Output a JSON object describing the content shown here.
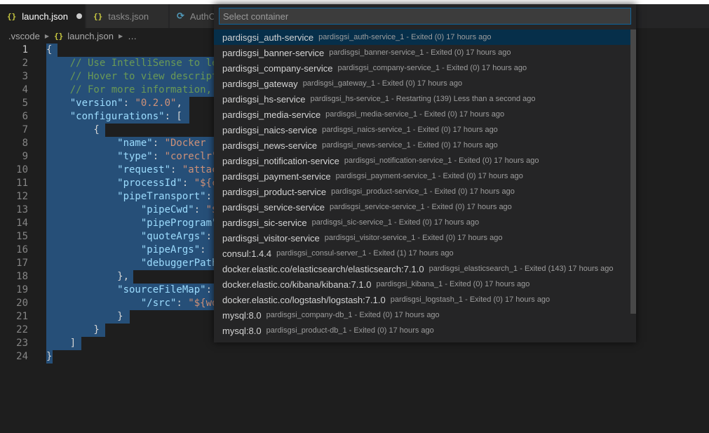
{
  "tabs": [
    {
      "label": "launch.json",
      "icon": "{}",
      "active": true,
      "dirty": true
    },
    {
      "label": "tasks.json",
      "icon": "{}",
      "active": false
    },
    {
      "label": "AuthC",
      "icon": "C#",
      "active": false
    }
  ],
  "breadcrumb": {
    "folder": ".vscode",
    "file": "launch.json",
    "more": "…"
  },
  "editor": {
    "lines": [
      {
        "n": "1",
        "tokens": [
          [
            "pun",
            "{"
          ]
        ]
      },
      {
        "n": "2",
        "tokens": [
          [
            "com",
            "    // Use IntelliSense to le"
          ]
        ]
      },
      {
        "n": "3",
        "tokens": [
          [
            "com",
            "    // Hover to view descript"
          ]
        ]
      },
      {
        "n": "4",
        "tokens": [
          [
            "com",
            "    // For more information, "
          ]
        ]
      },
      {
        "n": "5",
        "tokens": [
          [
            "key",
            "    \"version\""
          ],
          [
            "pun",
            ": "
          ],
          [
            "str",
            "\"0.2.0\""
          ],
          [
            "pun",
            ","
          ]
        ]
      },
      {
        "n": "6",
        "tokens": [
          [
            "key",
            "    \"configurations\""
          ],
          [
            "pun",
            ": ["
          ]
        ]
      },
      {
        "n": "7",
        "tokens": [
          [
            "pun",
            "        {"
          ]
        ]
      },
      {
        "n": "8",
        "tokens": [
          [
            "key",
            "            \"name\""
          ],
          [
            "pun",
            ": "
          ],
          [
            "str",
            "\"Docker ."
          ]
        ]
      },
      {
        "n": "9",
        "tokens": [
          [
            "key",
            "            \"type\""
          ],
          [
            "pun",
            ": "
          ],
          [
            "str",
            "\"coreclr\""
          ]
        ]
      },
      {
        "n": "10",
        "tokens": [
          [
            "key",
            "            \"request\""
          ],
          [
            "pun",
            ": "
          ],
          [
            "str",
            "\"attac"
          ]
        ]
      },
      {
        "n": "11",
        "tokens": [
          [
            "key",
            "            \"processId\""
          ],
          [
            "pun",
            ": "
          ],
          [
            "str",
            "\"${c"
          ]
        ]
      },
      {
        "n": "12",
        "tokens": [
          [
            "key",
            "            \"pipeTransport\""
          ],
          [
            "pun",
            ":"
          ]
        ]
      },
      {
        "n": "13",
        "tokens": [
          [
            "key",
            "                \"pipeCwd\""
          ],
          [
            "pun",
            ": "
          ],
          [
            "str",
            "\"$"
          ]
        ]
      },
      {
        "n": "14",
        "tokens": [
          [
            "key",
            "                \"pipeProgram\""
          ]
        ]
      },
      {
        "n": "15",
        "tokens": [
          [
            "key",
            "                \"quoteArgs\""
          ],
          [
            "pun",
            ":"
          ]
        ]
      },
      {
        "n": "16",
        "tokens": [
          [
            "key",
            "                \"pipeArgs\""
          ],
          [
            "pun",
            ": ["
          ]
        ]
      },
      {
        "n": "17",
        "tokens": [
          [
            "key",
            "                \"debuggerPath"
          ]
        ]
      },
      {
        "n": "18",
        "tokens": [
          [
            "pun",
            "            },"
          ]
        ]
      },
      {
        "n": "19",
        "tokens": [
          [
            "key",
            "            \"sourceFileMap\""
          ],
          [
            "pun",
            ":"
          ]
        ]
      },
      {
        "n": "20",
        "tokens": [
          [
            "key",
            "                \"/src\""
          ],
          [
            "pun",
            ": "
          ],
          [
            "str",
            "\"${wo"
          ]
        ]
      },
      {
        "n": "21",
        "tokens": [
          [
            "pun",
            "            }"
          ]
        ]
      },
      {
        "n": "22",
        "tokens": [
          [
            "pun",
            "        }"
          ]
        ]
      },
      {
        "n": "23",
        "tokens": [
          [
            "pun",
            "    ]"
          ]
        ]
      },
      {
        "n": "24",
        "tokens": [
          [
            "pun",
            "}"
          ]
        ]
      }
    ]
  },
  "quickpick": {
    "placeholder": "Select container",
    "items": [
      {
        "label": "pardisgsi_auth-service",
        "description": "pardisgsi_auth-service_1 - Exited (0) 17 hours ago",
        "active": true
      },
      {
        "label": "pardisgsi_banner-service",
        "description": "pardisgsi_banner-service_1 - Exited (0) 17 hours ago"
      },
      {
        "label": "pardisgsi_company-service",
        "description": "pardisgsi_company-service_1 - Exited (0) 17 hours ago"
      },
      {
        "label": "pardisgsi_gateway",
        "description": "pardisgsi_gateway_1 - Exited (0) 17 hours ago"
      },
      {
        "label": "pardisgsi_hs-service",
        "description": "pardisgsi_hs-service_1 - Restarting (139) Less than a second ago"
      },
      {
        "label": "pardisgsi_media-service",
        "description": "pardisgsi_media-service_1 - Exited (0) 17 hours ago"
      },
      {
        "label": "pardisgsi_naics-service",
        "description": "pardisgsi_naics-service_1 - Exited (0) 17 hours ago"
      },
      {
        "label": "pardisgsi_news-service",
        "description": "pardisgsi_news-service_1 - Exited (0) 17 hours ago"
      },
      {
        "label": "pardisgsi_notification-service",
        "description": "pardisgsi_notification-service_1 - Exited (0) 17 hours ago"
      },
      {
        "label": "pardisgsi_payment-service",
        "description": "pardisgsi_payment-service_1 - Exited (0) 17 hours ago"
      },
      {
        "label": "pardisgsi_product-service",
        "description": "pardisgsi_product-service_1 - Exited (0) 17 hours ago"
      },
      {
        "label": "pardisgsi_service-service",
        "description": "pardisgsi_service-service_1 - Exited (0) 17 hours ago"
      },
      {
        "label": "pardisgsi_sic-service",
        "description": "pardisgsi_sic-service_1 - Exited (0) 17 hours ago"
      },
      {
        "label": "pardisgsi_visitor-service",
        "description": "pardisgsi_visitor-service_1 - Exited (0) 17 hours ago"
      },
      {
        "label": "consul:1.4.4",
        "description": "pardisgsi_consul-server_1 - Exited (1) 17 hours ago"
      },
      {
        "label": "docker.elastic.co/elasticsearch/elasticsearch:7.1.0",
        "description": "pardisgsi_elasticsearch_1 - Exited (143) 17 hours ago"
      },
      {
        "label": "docker.elastic.co/kibana/kibana:7.1.0",
        "description": "pardisgsi_kibana_1 - Exited (0) 17 hours ago"
      },
      {
        "label": "docker.elastic.co/logstash/logstash:7.1.0",
        "description": "pardisgsi_logstash_1 - Exited (0) 17 hours ago"
      },
      {
        "label": "mysql:8.0",
        "description": "pardisgsi_company-db_1 - Exited (0) 17 hours ago"
      },
      {
        "label": "mysql:8.0",
        "description": "pardisgsi_product-db_1 - Exited (0) 17 hours ago"
      }
    ]
  }
}
